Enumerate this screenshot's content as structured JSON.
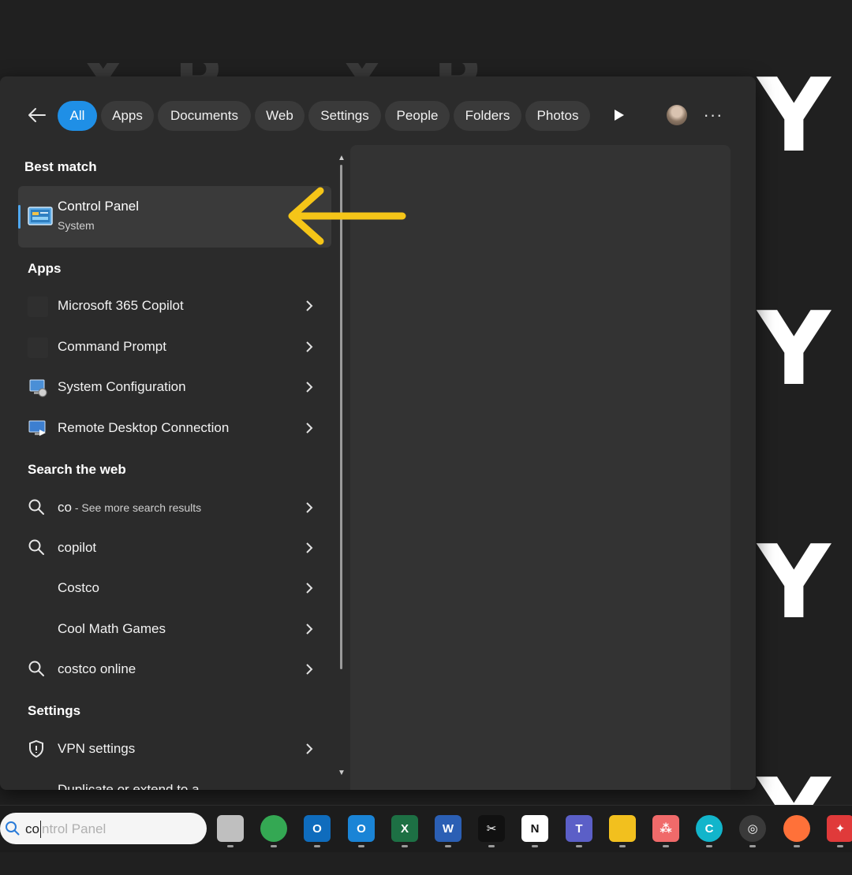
{
  "background": {
    "faint_text": "XP XP XP",
    "side_letters": [
      "Y",
      "Y",
      "Y",
      "Y"
    ]
  },
  "filters": {
    "back_icon": "back-arrow-icon",
    "chips": [
      {
        "label": "All",
        "active": true
      },
      {
        "label": "Apps",
        "active": false
      },
      {
        "label": "Documents",
        "active": false
      },
      {
        "label": "Web",
        "active": false
      },
      {
        "label": "Settings",
        "active": false
      },
      {
        "label": "People",
        "active": false
      },
      {
        "label": "Folders",
        "active": false
      },
      {
        "label": "Photos",
        "active": false
      }
    ],
    "more_icon": "play-icon",
    "ellipsis": "···"
  },
  "best_match": {
    "heading": "Best match",
    "title": "Control Panel",
    "subtitle": "System"
  },
  "apps": {
    "heading": "Apps",
    "items": [
      {
        "label": "Microsoft 365 Copilot"
      },
      {
        "label": "Command Prompt"
      },
      {
        "label": "System Configuration"
      },
      {
        "label": "Remote Desktop Connection"
      }
    ]
  },
  "web": {
    "heading": "Search the web",
    "items": [
      {
        "label": "co",
        "suffix": " - See more search results",
        "icon": true
      },
      {
        "label": "copilot",
        "suffix": "",
        "icon": true
      },
      {
        "label": "Costco",
        "suffix": "",
        "icon": false
      },
      {
        "label": "Cool Math Games",
        "suffix": "",
        "icon": false
      },
      {
        "label": "costco online",
        "suffix": "",
        "icon": true
      }
    ]
  },
  "settings": {
    "heading": "Settings",
    "items": [
      {
        "label": "VPN settings"
      }
    ],
    "cut_item": "Duplicate or extend to a..."
  },
  "taskbar": {
    "search_typed": "co",
    "search_hint": "ntrol Panel",
    "apps": [
      {
        "name": "task-view",
        "color": "#bfbfbf",
        "glyph": ""
      },
      {
        "name": "chrome",
        "color": "#34a853",
        "glyph": ""
      },
      {
        "name": "outlook",
        "color": "#0f6cbd",
        "glyph": "O"
      },
      {
        "name": "outlook-new",
        "color": "#1a84d6",
        "glyph": "O"
      },
      {
        "name": "excel",
        "color": "#1d7044",
        "glyph": "X"
      },
      {
        "name": "word",
        "color": "#2b5fb4",
        "glyph": "W"
      },
      {
        "name": "capcut",
        "color": "#111111",
        "glyph": "✂"
      },
      {
        "name": "notion",
        "color": "#ffffff",
        "glyph": "N"
      },
      {
        "name": "teams",
        "color": "#5b5fc7",
        "glyph": "T"
      },
      {
        "name": "file-explorer",
        "color": "#f2c01e",
        "glyph": ""
      },
      {
        "name": "asana",
        "color": "#f06a6a",
        "glyph": "⁂"
      },
      {
        "name": "canva",
        "color": "#12b5cb",
        "glyph": "C"
      },
      {
        "name": "obs",
        "color": "#3a3a3a",
        "glyph": "◎"
      },
      {
        "name": "firefox",
        "color": "#ff7139",
        "glyph": ""
      },
      {
        "name": "app-red",
        "color": "#e03a3a",
        "glyph": "✦"
      }
    ]
  }
}
